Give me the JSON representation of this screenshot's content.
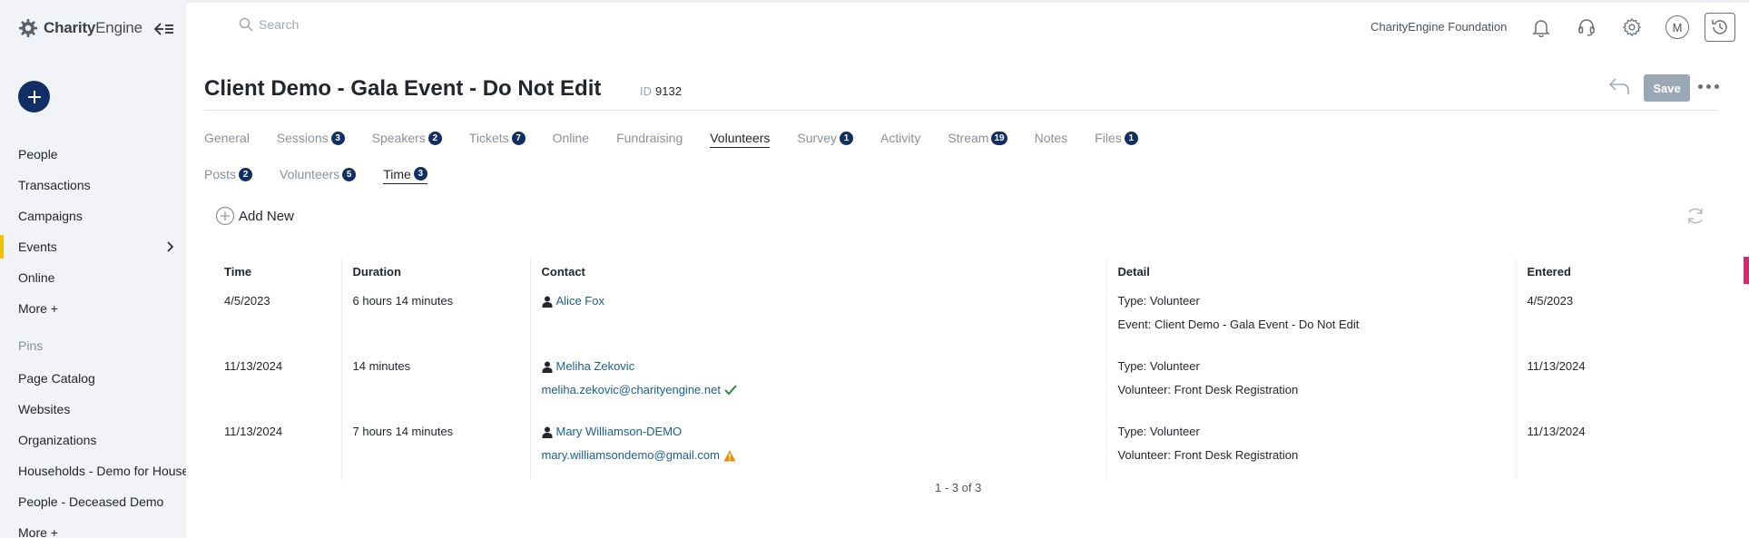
{
  "sidebar": {
    "logo": {
      "brand_bold": "Charity",
      "brand_light": "Engine"
    },
    "nav": [
      {
        "label": "People"
      },
      {
        "label": "Transactions"
      },
      {
        "label": "Campaigns"
      },
      {
        "label": "Events",
        "active": true
      },
      {
        "label": "Online"
      },
      {
        "label": "More +"
      }
    ],
    "pins_label": "Pins",
    "pins": [
      {
        "label": "Page Catalog"
      },
      {
        "label": "Websites"
      },
      {
        "label": "Organizations"
      },
      {
        "label": "Households - Demo for Households"
      },
      {
        "label": "People - Deceased Demo"
      },
      {
        "label": "More +"
      }
    ]
  },
  "topbar": {
    "search_placeholder": "Search",
    "org_name": "CharityEngine Foundation",
    "avatar_initial": "M",
    "icons": [
      "bell-icon",
      "headset-icon",
      "gear-icon",
      "history-icon"
    ]
  },
  "header": {
    "title": "Client Demo - Gala Event - Do Not Edit",
    "id_label": "ID",
    "id_value": "9132",
    "save_label": "Save"
  },
  "tabs_row1": [
    {
      "label": "General",
      "badge": ""
    },
    {
      "label": "Sessions",
      "badge": "3"
    },
    {
      "label": "Speakers",
      "badge": "2"
    },
    {
      "label": "Tickets",
      "badge": "7"
    },
    {
      "label": "Online",
      "badge": ""
    },
    {
      "label": "Fundraising",
      "badge": ""
    },
    {
      "label": "Volunteers",
      "badge": "",
      "active": true
    },
    {
      "label": "Survey",
      "badge": "1"
    },
    {
      "label": "Activity",
      "badge": ""
    },
    {
      "label": "Stream",
      "badge": "19"
    },
    {
      "label": "Notes",
      "badge": ""
    },
    {
      "label": "Files",
      "badge": "1"
    }
  ],
  "tabs_row2": [
    {
      "label": "Posts",
      "badge": "2"
    },
    {
      "label": "Volunteers",
      "badge": "5"
    },
    {
      "label": "Time",
      "badge": "3",
      "active": true
    }
  ],
  "toolbar": {
    "add_new_label": "Add New"
  },
  "table": {
    "columns": [
      "Time",
      "Duration",
      "Contact",
      "Detail",
      "Entered"
    ],
    "rows": [
      {
        "time": "4/5/2023",
        "duration": "6 hours 14 minutes",
        "contact_name": "Alice Fox",
        "contact_email": "",
        "email_status": "",
        "detail_1": "Type: Volunteer",
        "detail_2": "Event: Client Demo - Gala Event - Do Not Edit",
        "entered": "4/5/2023"
      },
      {
        "time": "11/13/2024",
        "duration": "14 minutes",
        "contact_name": "Meliha Zekovic",
        "contact_email": "meliha.zekovic@charityengine.net",
        "email_status": "verified",
        "detail_1": "Type: Volunteer",
        "detail_2": "Volunteer: Front Desk Registration",
        "entered": "11/13/2024"
      },
      {
        "time": "11/13/2024",
        "duration": "7 hours 14 minutes",
        "contact_name": "Mary Williamson-DEMO",
        "contact_email": "mary.williamsondemo@gmail.com",
        "email_status": "warning",
        "detail_1": "Type: Volunteer",
        "detail_2": "Volunteer: Front Desk Registration",
        "entered": "11/13/2024"
      }
    ]
  },
  "pager": {
    "text": "1 - 3 of 3"
  },
  "colors": {
    "brand_navy": "#112f66",
    "active_marker": "#f2c200",
    "link": "#1a5f96",
    "save_disabled": "#9aa7b4",
    "verified": "#2e8b3e",
    "warning": "#f08a00"
  }
}
